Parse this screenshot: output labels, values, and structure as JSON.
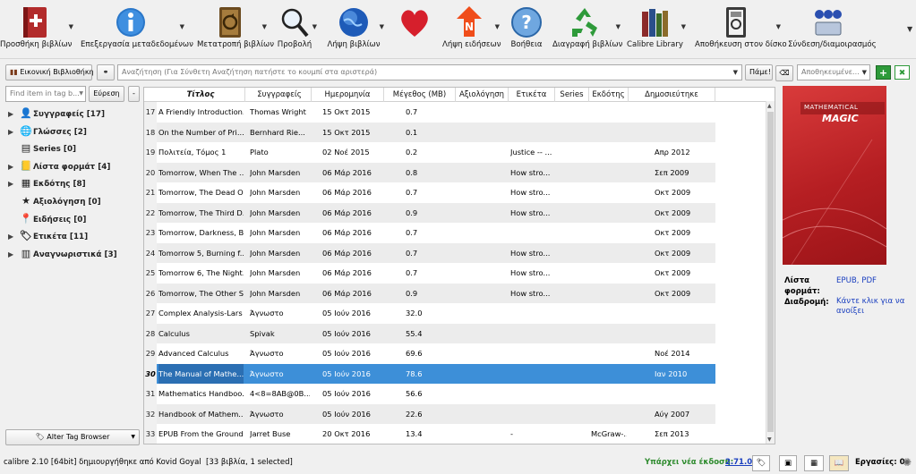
{
  "toolbar": {
    "add": "Προσθήκη βιβλίων",
    "edit": "Επεξεργασία μεταδεδομένων",
    "convert": "Μετατροπή βιβλίων",
    "view": "Προβολή",
    "get": "Λήψη βιβλίων",
    "news": "Λήψη ειδήσεων",
    "help": "Βοήθεια",
    "remove": "Διαγραφή βιβλίων",
    "library": "Calibre Library",
    "save": "Αποθήκευση στον δίσκο",
    "connect": "Σύνδεση/διαμοιρασμός"
  },
  "search": {
    "vlib": "Εικονική Βιβλιοθήκη",
    "placeholder": "Αναζήτηση (Για Σύνθετη Αναζήτηση πατήστε το κουμπί στα αριστερά)",
    "go": "Πάμε!",
    "saved": "Αποθηκευμένε..."
  },
  "tagbrowser": {
    "find_placeholder": "Find item in tag b...",
    "find_btn": "Εύρεση",
    "minus": "-",
    "alter": "Alter Tag Browser",
    "items": [
      {
        "label": "Συγγραφείς [17]",
        "icon": "👤",
        "arrow": true
      },
      {
        "label": "Γλώσσες [2]",
        "icon": "🌐",
        "arrow": true
      },
      {
        "label": "Series [0]",
        "icon": "▤",
        "arrow": false
      },
      {
        "label": "Λίστα φορμάτ [4]",
        "icon": "📒",
        "arrow": true
      },
      {
        "label": "Εκδότης [8]",
        "icon": "▦",
        "arrow": true
      },
      {
        "label": "Αξιολόγηση [0]",
        "icon": "★",
        "arrow": false
      },
      {
        "label": "Ειδήσεις [0]",
        "icon": "📍",
        "arrow": false
      },
      {
        "label": "Ετικέτα [11]",
        "icon": "🏷",
        "arrow": true
      },
      {
        "label": "Αναγνωριστικά [3]",
        "icon": "▥",
        "arrow": true
      }
    ]
  },
  "table": {
    "headers": [
      "Τίτλος",
      "Συγγραφείς",
      "Ημερομηνία",
      "Μέγεθος (MB)",
      "Αξιολόγηση",
      "Ετικέτα",
      "Series",
      "Εκδότης",
      "Δημοσιεύτηκε"
    ],
    "rows": [
      {
        "n": "17",
        "title": "A Friendly Introduction...",
        "author": "Thomas Wright",
        "date": "15 Οκτ 2015",
        "size": "0.7",
        "tags": "",
        "publisher": "",
        "pub": ""
      },
      {
        "n": "18",
        "title": "On the Number of Pri...",
        "author": "Bernhard Rie...",
        "date": "15 Οκτ 2015",
        "size": "0.1",
        "tags": "",
        "publisher": "",
        "pub": ""
      },
      {
        "n": "19",
        "title": "Πολιτεία, Τόμος 1",
        "author": "Plato",
        "date": "02 Νοέ 2015",
        "size": "0.2",
        "tags": "Justice -- ...",
        "publisher": "",
        "pub": "Απρ 2012"
      },
      {
        "n": "20",
        "title": "Tomorrow, When The ...",
        "author": "John Marsden",
        "date": "06 Μάρ 2016",
        "size": "0.8",
        "tags": "How stro...",
        "publisher": "",
        "pub": "Σεπ 2009"
      },
      {
        "n": "21",
        "title": "Tomorrow, The Dead O...",
        "author": "John Marsden",
        "date": "06 Μάρ 2016",
        "size": "0.7",
        "tags": "How stro...",
        "publisher": "",
        "pub": "Οκτ 2009"
      },
      {
        "n": "22",
        "title": "Tomorrow, The Third D...",
        "author": "John Marsden",
        "date": "06 Μάρ 2016",
        "size": "0.9",
        "tags": "How stro...",
        "publisher": "",
        "pub": "Οκτ 2009"
      },
      {
        "n": "23",
        "title": "Tomorrow, Darkness, B...",
        "author": "John Marsden",
        "date": "06 Μάρ 2016",
        "size": "0.7",
        "tags": "",
        "publisher": "",
        "pub": "Οκτ 2009"
      },
      {
        "n": "24",
        "title": "Tomorrow 5, Burning f...",
        "author": "John Marsden",
        "date": "06 Μάρ 2016",
        "size": "0.7",
        "tags": "How stro...",
        "publisher": "",
        "pub": "Οκτ 2009"
      },
      {
        "n": "25",
        "title": "Tomorrow 6, The Night...",
        "author": "John Marsden",
        "date": "06 Μάρ 2016",
        "size": "0.7",
        "tags": "How stro...",
        "publisher": "",
        "pub": "Οκτ 2009"
      },
      {
        "n": "26",
        "title": "Tomorrow, The Other S...",
        "author": "John Marsden",
        "date": "06 Μάρ 2016",
        "size": "0.9",
        "tags": "How stro...",
        "publisher": "",
        "pub": "Οκτ 2009"
      },
      {
        "n": "27",
        "title": "Complex Analysis-Lars ...",
        "author": "Άγνωστο",
        "date": "05 Ιούν 2016",
        "size": "32.0",
        "tags": "",
        "publisher": "",
        "pub": ""
      },
      {
        "n": "28",
        "title": "Calculus",
        "author": "Spivak",
        "date": "05 Ιούν 2016",
        "size": "55.4",
        "tags": "",
        "publisher": "",
        "pub": ""
      },
      {
        "n": "29",
        "title": "Advanced Calculus",
        "author": "Άγνωστο",
        "date": "05 Ιούν 2016",
        "size": "69.6",
        "tags": "",
        "publisher": "",
        "pub": "Νοέ 2014"
      },
      {
        "n": "30",
        "title": "The Manual of Mathe...",
        "author": "Άγνωστο",
        "date": "05 Ιούν 2016",
        "size": "78.6",
        "tags": "",
        "publisher": "",
        "pub": "Ιαν 2010",
        "selected": true
      },
      {
        "n": "31",
        "title": "Mathematics Handboo...",
        "author": "4<8=8AB@0B...",
        "date": "05 Ιούν 2016",
        "size": "56.6",
        "tags": "",
        "publisher": "",
        "pub": ""
      },
      {
        "n": "32",
        "title": "Handbook of Mathem...",
        "author": "Άγνωστο",
        "date": "05 Ιούν 2016",
        "size": "22.6",
        "tags": "",
        "publisher": "",
        "pub": "Αύγ 2007"
      },
      {
        "n": "33",
        "title": "EPUB From the Ground...",
        "author": "Jarret Buse",
        "date": "20 Οκτ 2016",
        "size": "13.4",
        "tags": "-",
        "publisher": "McGraw-...",
        "pub": "Σεπ 2013"
      }
    ]
  },
  "details": {
    "cover_title_line1": "MATHEMATICAL",
    "cover_title_line2": "MAGIC",
    "formats_label": "Λίστα φορμάτ:",
    "formats_value": "EPUB, PDF",
    "path_label": "Διαδρομή:",
    "path_value": "Κάντε κλικ για να ανοίξει"
  },
  "status": {
    "left": "calibre 2.10 [64bit] δημιουργήθηκε από Kovid Goyal",
    "count": "[33 βιβλία, 1 selected]",
    "update_text": "Υπάρχει νέα έκδοση:",
    "update_version": "2.71.0",
    "jobs": "Εργασίες: 0"
  },
  "colors": {
    "selection": "#3d8fd8",
    "update_green": "#2e8b2e",
    "link_blue": "#1a3fbf"
  }
}
